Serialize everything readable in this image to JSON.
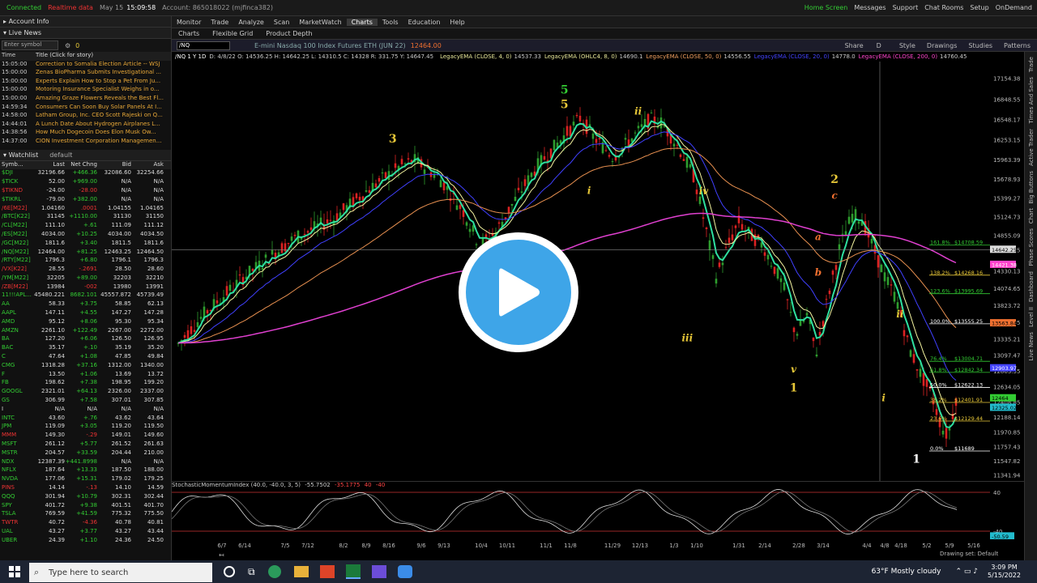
{
  "status": {
    "connected": "Connected",
    "realtime": "Realtime data",
    "datetime": "May 15",
    "time": "15:09:58",
    "account": "Account: 865018022 (mjfinca382)",
    "links": [
      "Home Screen",
      "Messages",
      "Support",
      "Chat Rooms",
      "Setup"
    ],
    "ondemand": "OnDemand"
  },
  "left": {
    "account_info": "Account Info",
    "live_news": "Live News",
    "enter_symbol": "Enter symbol",
    "news_cols": [
      "Time",
      "Title (Click for story)"
    ],
    "news": [
      {
        "t": "15:05:00",
        "h": "Correction to Somalia Election Article -- WSJ"
      },
      {
        "t": "15:00:00",
        "h": "Zenas BioPharma Submits Investigational ..."
      },
      {
        "t": "15:00:00",
        "h": "Experts Explain How to Stop a Pet From Ju..."
      },
      {
        "t": "15:00:00",
        "h": "Motoring Insurance Specialist Weighs in o..."
      },
      {
        "t": "15:00:00",
        "h": "Amazing Graze Flowers Reveals the Best Fl..."
      },
      {
        "t": "14:59:34",
        "h": "Consumers Can Soon Buy Solar Panels At I..."
      },
      {
        "t": "14:58:00",
        "h": "Latham Group, Inc. CEO Scott Rajeski on Q..."
      },
      {
        "t": "14:44:01",
        "h": "A Lunch Date About Hydrogen Airplanes L..."
      },
      {
        "t": "14:38:56",
        "h": "How Much Dogecoin Does Elon Musk Ow..."
      },
      {
        "t": "14:37:00",
        "h": "CION Investment Corporation Managemen..."
      }
    ],
    "watchlist": "Watchlist",
    "watchlist_name": "default",
    "wl_cols": [
      "Symb...",
      "Last",
      "Net Chng",
      "Bid",
      "Ask"
    ],
    "wl": [
      [
        "$DJI",
        "32196.66",
        "+466.36",
        "32086.60",
        "32254.66",
        "g"
      ],
      [
        "$TICK",
        "52.00",
        "+969.00",
        "N/A",
        "N/A",
        "g"
      ],
      [
        "$TIKND",
        "-24.00",
        "-28.00",
        "N/A",
        "N/A",
        "r"
      ],
      [
        "$TIKRL",
        "-79.00",
        "+382.00",
        "N/A",
        "N/A",
        "g"
      ],
      [
        "/6E[M22]",
        "1.04160",
        ".0001",
        "1.04155",
        "1.04165",
        "r"
      ],
      [
        "/BTC[K22]",
        "31145",
        "+1110.00",
        "31130",
        "31150",
        "g"
      ],
      [
        "/CL[M22]",
        "111.10",
        "+.61",
        "111.09",
        "111.12",
        "g"
      ],
      [
        "/ES[M22]",
        "4034.00",
        "+10.25",
        "4034.00",
        "4034.50",
        "g"
      ],
      [
        "/GC[M22]",
        "1811.6",
        "+3.40",
        "1811.5",
        "1811.6",
        "g"
      ],
      [
        "/NQ[M22]",
        "12464.00",
        "+81.25",
        "12463.25",
        "12464.50",
        "g"
      ],
      [
        "/RTY[M22]",
        "1796.3",
        "+6.80",
        "1796.1",
        "1796.3",
        "g"
      ],
      [
        "/VX[K22]",
        "28.55",
        "-.2691",
        "28.50",
        "28.60",
        "r"
      ],
      [
        "/YM[M22]",
        "32205",
        "+89.00",
        "32203",
        "32210",
        "g"
      ],
      [
        "/ZB[M22]",
        "13984",
        "-002",
        "13980",
        "13991",
        "r"
      ],
      [
        "11!!!APL...",
        "45480.221",
        "8682.101",
        "45557.872",
        "45739.49",
        "g"
      ],
      [
        "AA",
        "58.33",
        "+3.75",
        "58.85",
        "62.13",
        "g"
      ],
      [
        "AAPL",
        "147.11",
        "+4.55",
        "147.27",
        "147.28",
        "g"
      ],
      [
        "AMD",
        "95.12",
        "+8.06",
        "95.30",
        "95.34",
        "g"
      ],
      [
        "AMZN",
        "2261.10",
        "+122.49",
        "2267.00",
        "2272.00",
        "g"
      ],
      [
        "BA",
        "127.20",
        "+6.06",
        "126.50",
        "126.95",
        "g"
      ],
      [
        "BAC",
        "35.17",
        "+.10",
        "35.19",
        "35.20",
        "g"
      ],
      [
        "C",
        "47.64",
        "+1.08",
        "47.85",
        "49.84",
        "g"
      ],
      [
        "CMG",
        "1318.28",
        "+37.16",
        "1312.00",
        "1340.00",
        "g"
      ],
      [
        "F",
        "13.50",
        "+1.06",
        "13.69",
        "13.72",
        "g"
      ],
      [
        "FB",
        "198.62",
        "+7.38",
        "198.95",
        "199.20",
        "g"
      ],
      [
        "GOOGL",
        "2321.01",
        "+64.13",
        "2326.00",
        "2337.00",
        "g"
      ],
      [
        "GS",
        "306.99",
        "+7.58",
        "307.01",
        "307.85",
        "g"
      ],
      [
        "I",
        "N/A",
        "N/A",
        "N/A",
        "N/A",
        "w"
      ],
      [
        "INTC",
        "43.60",
        "+.76",
        "43.62",
        "43.64",
        "g"
      ],
      [
        "JPM",
        "119.09",
        "+3.05",
        "119.20",
        "119.50",
        "g"
      ],
      [
        "MMM",
        "149.30",
        "-.29",
        "149.01",
        "149.60",
        "r"
      ],
      [
        "MSFT",
        "261.12",
        "+5.77",
        "261.52",
        "261.63",
        "g"
      ],
      [
        "MSTR",
        "204.57",
        "+33.59",
        "204.44",
        "210.00",
        "g"
      ],
      [
        "NDX",
        "12387.39",
        "+441.8998",
        "N/A",
        "N/A",
        "g"
      ],
      [
        "NFLX",
        "187.64",
        "+13.33",
        "187.50",
        "188.00",
        "g"
      ],
      [
        "NVDA",
        "177.06",
        "+15.31",
        "179.02",
        "179.25",
        "g"
      ],
      [
        "PINS",
        "14.14",
        "-.13",
        "14.10",
        "14.59",
        "r"
      ],
      [
        "QQQ",
        "301.94",
        "+10.79",
        "302.31",
        "302.44",
        "g"
      ],
      [
        "SPY",
        "401.72",
        "+9.38",
        "401.51",
        "401.70",
        "g"
      ],
      [
        "TSLA",
        "769.59",
        "+41.59",
        "775.32",
        "775.50",
        "g"
      ],
      [
        "TWTR",
        "40.72",
        "-4.36",
        "40.78",
        "40.81",
        "r"
      ],
      [
        "UAL",
        "43.27",
        "+3.77",
        "43.27",
        "43.44",
        "g"
      ],
      [
        "UBER",
        "24.39",
        "+1.10",
        "24.36",
        "24.50",
        "g"
      ]
    ]
  },
  "nav": {
    "items": [
      "Monitor",
      "Trade",
      "Analyze",
      "Scan",
      "MarketWatch",
      "Charts",
      "Tools",
      "Education",
      "Help"
    ],
    "sub": [
      "Charts",
      "Flexible Grid",
      "Product Depth"
    ]
  },
  "toolbar": {
    "symbol": "/NQ",
    "desc": "E-mini Nasdaq 100 Index Futures ETH (JUN 22)",
    "price": "12464.00",
    "buttons": [
      "Share",
      "D",
      "Style",
      "Drawings",
      "Studies",
      "Patterns"
    ]
  },
  "studybar": {
    "period": "/NQ 1 Y 1D",
    "ohlc": "D: 4/8/22  O: 14536.25  H: 14642.25  L: 14310.5  C: 14328  R: 331.75  Y: 14647.45",
    "studies": [
      {
        "label": "LegacyEMA (CLOSE, 4, 0)",
        "value": "14537.33",
        "color": "#e8e89a"
      },
      {
        "label": "LegacyEMA (OHLC4, 8, 0)",
        "value": "14690.1",
        "color": "#e8e89a"
      },
      {
        "label": "LegacyEMA (CLOSE, 50, 0)",
        "value": "14556.55",
        "color": "#f0a060"
      },
      {
        "label": "LegacyEMA (CLOSE, 20, 0)",
        "value": "14778.0",
        "color": "#4444ff"
      },
      {
        "label": "LegacyEMA (CLOSE, 200, 0)",
        "value": "14760.45",
        "color": "#ff44cc"
      }
    ]
  },
  "chart_data": {
    "type": "candlestick",
    "symbol": "/NQ",
    "ylim": [
      11250,
      17400
    ],
    "y_ticks": [
      "17154.38",
      "16848.55",
      "16548.17",
      "16253.15",
      "15963.39",
      "15678.93",
      "15399.27",
      "15124.73",
      "14855.09",
      "14642.25",
      "14330.13",
      "14074.65",
      "13823.72",
      "13578.35",
      "13335.21",
      "13097.47",
      "12863.55",
      "12634.05",
      "12408.85",
      "12188.14",
      "11970.85",
      "11757.43",
      "11547.82",
      "11341.94"
    ],
    "x_ticks": [
      "6/7",
      "6/14",
      "7/5",
      "7/12",
      "8/2",
      "8/9",
      "8/16",
      "9/6",
      "9/13",
      "10/4",
      "10/11",
      "11/1",
      "11/8",
      "11/29",
      "12/13",
      "1/3",
      "1/10",
      "1/31",
      "2/14",
      "2/28",
      "3/14",
      "4/4",
      "4/8",
      "4/18",
      "5/2",
      "5/9",
      "5/16"
    ],
    "wave_labels": [
      {
        "text": "3",
        "x": 0.27,
        "y": 16210,
        "color": "#e8c838"
      },
      {
        "text": "5",
        "x": 0.48,
        "y": 16930,
        "color": "#3c3"
      },
      {
        "text": "5",
        "x": 0.48,
        "y": 16720,
        "color": "#e8c838"
      },
      {
        "text": "ii",
        "x": 0.57,
        "y": 16620,
        "color": "#e8c838"
      },
      {
        "text": "i",
        "x": 0.51,
        "y": 15460,
        "color": "#e8c838"
      },
      {
        "text": "iv",
        "x": 0.65,
        "y": 15450,
        "color": "#e8c838"
      },
      {
        "text": "iii",
        "x": 0.63,
        "y": 13300,
        "color": "#e8c838"
      },
      {
        "text": "v",
        "x": 0.76,
        "y": 12840,
        "color": "#e8c838"
      },
      {
        "text": "1",
        "x": 0.76,
        "y": 12560,
        "color": "#e8c838"
      },
      {
        "text": "2",
        "x": 0.81,
        "y": 15620,
        "color": "#e8c838"
      },
      {
        "text": "c",
        "x": 0.81,
        "y": 15390,
        "color": "#f07030"
      },
      {
        "text": "a",
        "x": 0.79,
        "y": 14780,
        "color": "#f07030"
      },
      {
        "text": "b",
        "x": 0.79,
        "y": 14260,
        "color": "#f07030"
      },
      {
        "text": "ii",
        "x": 0.89,
        "y": 13650,
        "color": "#e8c838"
      },
      {
        "text": "i",
        "x": 0.87,
        "y": 12420,
        "color": "#e8c838"
      },
      {
        "text": "1",
        "x": 0.91,
        "y": 11520,
        "color": "#fff"
      }
    ],
    "fib_levels": [
      {
        "pct": "161.8%",
        "price": "$14708.59",
        "color": "#3c3"
      },
      {
        "pct": "138.2%",
        "price": "$14268.16",
        "color": "#e8c838"
      },
      {
        "pct": "123.6%",
        "price": "$13995.69",
        "color": "#3c3"
      },
      {
        "pct": "100.0%",
        "price": "$13555.25",
        "color": "#fff"
      },
      {
        "pct": "76.4%",
        "price": "$13004.71",
        "color": "#3c3"
      },
      {
        "pct": "61.8%",
        "price": "$12842.34",
        "color": "#3c3"
      },
      {
        "pct": "50.0%",
        "price": "$12622.13",
        "color": "#fff"
      },
      {
        "pct": "38.2%",
        "price": "$12401.91",
        "color": "#e8c838"
      },
      {
        "pct": "23.6%",
        "price": "$12129.44",
        "color": "#e8c838"
      },
      {
        "pct": "0.0%",
        "price": "$11689",
        "color": "#fff"
      }
    ],
    "price_tags": [
      {
        "price": "14642.25",
        "bg": "#ddd",
        "fg": "#000",
        "y": 14642
      },
      {
        "price": "14421.38",
        "bg": "#ff44cc",
        "fg": "#fff",
        "y": 14421
      },
      {
        "price": "13563.84",
        "bg": "#f07030",
        "fg": "#000",
        "y": 13564
      },
      {
        "price": "12903.97",
        "bg": "#4444ff",
        "fg": "#fff",
        "y": 12904
      },
      {
        "price": "12464",
        "bg": "#3c3",
        "fg": "#000",
        "y": 12464
      },
      {
        "price": "12325.02",
        "bg": "#2bc",
        "fg": "#000",
        "y": 12325
      }
    ],
    "oscillator": {
      "label": "StochasticMomentumIndex (40.0, -40.0, 3, 5)",
      "value": "-55.7502",
      "v2": "-35.1775",
      "v3": "40",
      "v4": "-40",
      "levels": [
        40,
        -40
      ],
      "last": "-50.59"
    }
  },
  "rightbar": [
    "Trade",
    "Times And Sales",
    "Active Trader",
    "Big Buttons",
    "Chart",
    "Phase Scores",
    "Dashboard",
    "Level II",
    "Live News"
  ],
  "footer": {
    "drawing_set": "Drawing set: Default"
  },
  "taskbar": {
    "search": "Type here to search",
    "weather": "63°F  Mostly cloudy",
    "time": "3:09 PM",
    "date": "5/15/2022"
  }
}
